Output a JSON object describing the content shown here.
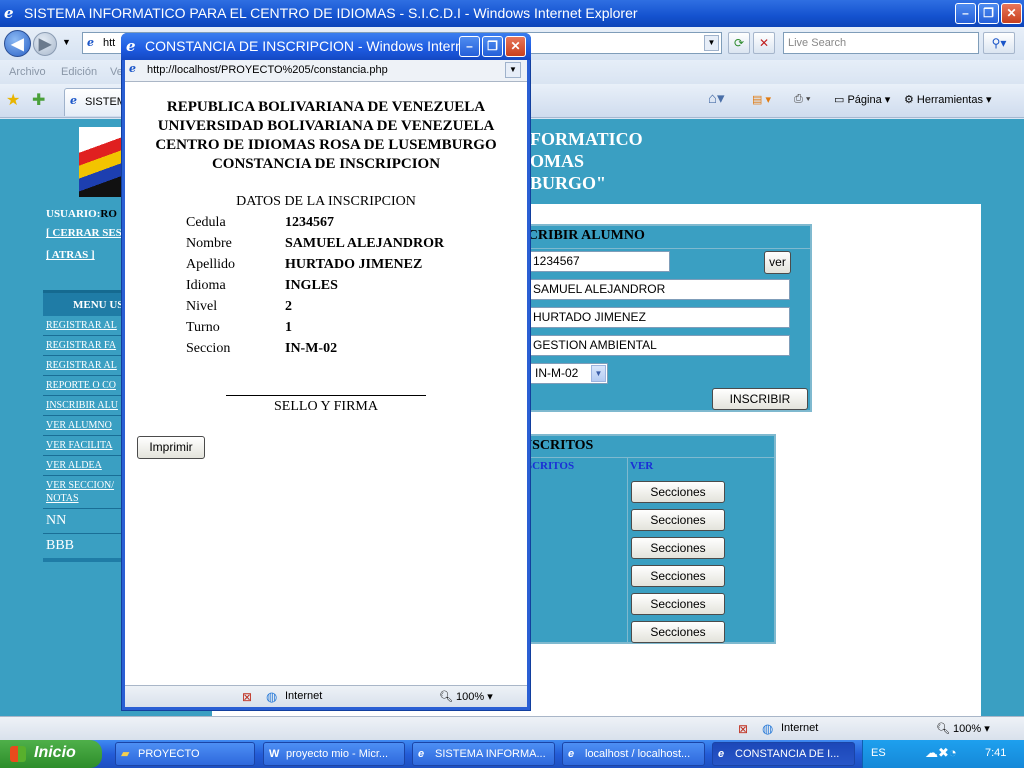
{
  "main_window": {
    "title": "SISTEMA INFORMATICO PARA EL CENTRO DE IDIOMAS - S.I.C.D.I - Windows Internet Explorer",
    "address_partial": "htt",
    "live_search_placeholder": "Live Search",
    "menu": [
      "Archivo",
      "Edición",
      "Ve"
    ],
    "tab_label": "SISTEM",
    "commands": {
      "page": "Página",
      "tools": "Herramientas"
    },
    "status": {
      "zone": "Internet",
      "zoom": "100%"
    }
  },
  "banner": {
    "line1": "FORMATICO",
    "line2": "OMAS",
    "line3": "BURGO\""
  },
  "left": {
    "user_label": "USUARIO:",
    "user_value": "RO",
    "logout": "[ CERRAR SES",
    "back": "[ ATRAS ]",
    "menu_title": "MENU US",
    "menu_items": [
      "REGISTRAR AL",
      "REGISTRAR FA",
      "REGISTRAR AL",
      "REPORTE O CO",
      "INSCRIBIR ALU",
      "VER ALUMNO",
      "VER FACILITA",
      "VER ALDEA",
      "VER SECCION/",
      "NOTAS"
    ],
    "extra_items": [
      "NN",
      "BBB"
    ]
  },
  "inscribir": {
    "title": "SCRIBIR ALUMNO",
    "cedula": "1234567",
    "ver_button": "ver",
    "nombre": "SAMUEL ALEJANDROR",
    "apellido": "HURTADO JIMENEZ",
    "aldea": "GESTION AMBIENTAL",
    "seccion": "IN-M-02",
    "submit": "INSCRIBIR"
  },
  "inscritos": {
    "title": "NSCRITOS",
    "col1": "SCRITOS",
    "col2": "VER",
    "row_button": "Secciones",
    "rows": 6
  },
  "popup": {
    "title": "CONSTANCIA DE INSCRIPCION - Windows Intern...",
    "url": "http://localhost/PROYECTO%205/constancia.php",
    "header_lines": [
      "REPUBLICA BOLIVARIANA DE VENEZUELA",
      "UNIVERSIDAD BOLIVARIANA DE VENEZUELA",
      "CENTRO DE IDIOMAS ROSA DE LUSEMBURGO",
      "CONSTANCIA DE INSCRIPCION"
    ],
    "subtitle": "DATOS DE LA INSCRIPCION",
    "fields": [
      {
        "label": "Cedula",
        "value": "1234567"
      },
      {
        "label": "Nombre",
        "value": "SAMUEL ALEJANDROR"
      },
      {
        "label": "Apellido",
        "value": "HURTADO JIMENEZ"
      },
      {
        "label": "Idioma",
        "value": "INGLES"
      },
      {
        "label": "Nivel",
        "value": "2"
      },
      {
        "label": "Turno",
        "value": "1"
      },
      {
        "label": "Seccion",
        "value": "IN-M-02"
      }
    ],
    "signature": "SELLO Y FIRMA",
    "print_button": "Imprimir",
    "status": {
      "zone": "Internet",
      "zoom": "100%"
    }
  },
  "taskbar": {
    "start": "Inicio",
    "tasks": [
      "PROYECTO",
      "proyecto mio - Micr...",
      "SISTEMA INFORMA...",
      "localhost / localhost...",
      "CONSTANCIA DE I..."
    ],
    "lang": "ES",
    "clock": "7:41"
  },
  "colors": {
    "page_bg": "#3a9fc2",
    "xp_blue": "#245dd8",
    "start_green": "#2d8d2a"
  }
}
